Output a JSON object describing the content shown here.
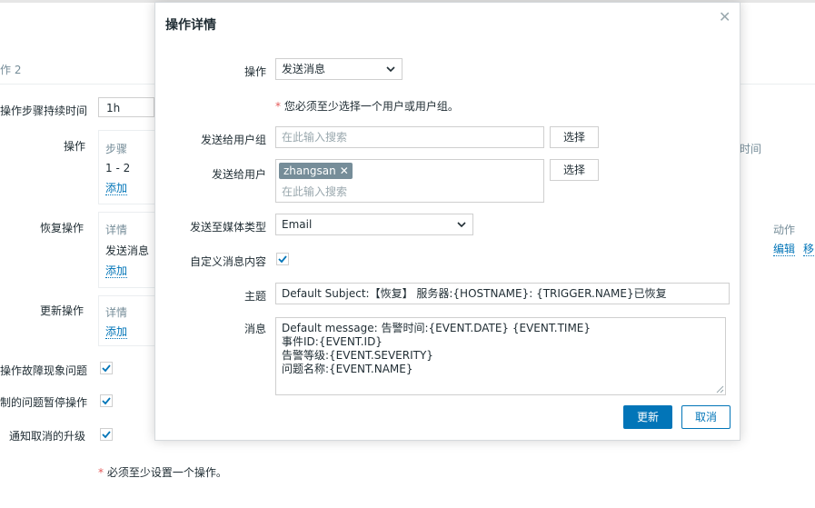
{
  "background": {
    "tab_label": "作 2",
    "step_duration_label": "操作步骤持续时间",
    "step_duration_value": "1h",
    "operations_label": "操作",
    "operations_header_steps": "步骤",
    "operations_row_step": "1 - 2",
    "operations_add": "添加",
    "operations_header_time": "时间",
    "recovery_label": "恢复操作",
    "recovery_header_details": "详情",
    "recovery_row_details": "发送消息",
    "recovery_add": "添加",
    "recovery_header_actions": "动作",
    "recovery_action_edit": "编辑",
    "recovery_action_remove": "移",
    "update_label": "更新操作",
    "update_header_details": "详情",
    "update_add": "添加",
    "pause_problem_label": "操作故障现象问题",
    "pause_suppressed_label": "制的问题暂停操作",
    "notify_cancel_label": "通知取消的升级",
    "required_note": "必须至少设置一个操作。"
  },
  "modal": {
    "title": "操作详情",
    "operation_label": "操作",
    "operation_value": "发送消息",
    "required_hint": "您必须至少选择一个用户或用户组。",
    "send_to_groups_label": "发送给用户组",
    "groups_placeholder": "在此输入搜索",
    "select_button": "选择",
    "send_to_users_label": "发送给用户",
    "user_tag": "zhangsan",
    "users_placeholder": "在此输入搜索",
    "media_type_label": "发送至媒体类型",
    "media_type_value": "Email",
    "custom_message_label": "自定义消息内容",
    "custom_message_checked": true,
    "subject_label": "主题",
    "subject_value": "Default Subject:【恢复】 服务器:{HOSTNAME}: {TRIGGER.NAME}已恢复",
    "message_label": "消息",
    "message_value": "Default message: 告警时间:{EVENT.DATE} {EVENT.TIME}\n事件ID:{EVENT.ID}\n告警等级:{EVENT.SEVERITY}\n问题名称:{EVENT.NAME}",
    "update_button": "更新",
    "cancel_button": "取消"
  },
  "colors": {
    "accent": "#0275b8",
    "required_star": "#e45959",
    "tag_bg": "#768d99"
  }
}
